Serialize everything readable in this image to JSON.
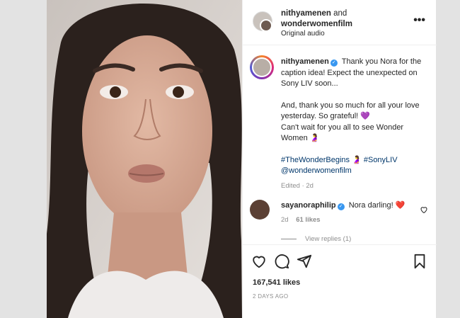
{
  "header": {
    "username": "nithyamenen",
    "conjunction": "and",
    "collaborator": "wonderwomenfilm",
    "audio": "Original audio",
    "more": "•••"
  },
  "caption": {
    "username": "nithyamenen",
    "para1": "Thank you Nora for the caption idea! Expect the unexpected on Sony LIV soon...",
    "para2": "And, thank you so much for all your love yesterday. So grateful! 💜",
    "para3": "Can't wait for you all to see Wonder Women 🤰",
    "hashtag1": "#TheWonderBegins",
    "emoji": "🤰",
    "hashtag2": "#SonyLIV",
    "mention": "@wonderwomenfilm",
    "edited": "Edited",
    "dot": "·",
    "time": "2d"
  },
  "comment": {
    "username": "sayanoraphilip",
    "text": "Nora darling! ❤️",
    "time": "2d",
    "likes": "61 likes",
    "view_replies": "View replies (1)"
  },
  "stats": {
    "likes": "167,541 likes",
    "posted": "2 DAYS AGO"
  },
  "icons": {
    "like": "heart-icon",
    "comment": "comment-icon",
    "share": "share-icon",
    "save": "bookmark-icon"
  },
  "colors": {
    "link": "#00376b",
    "verified": "#3897f0",
    "muted": "#8e8e8e"
  }
}
